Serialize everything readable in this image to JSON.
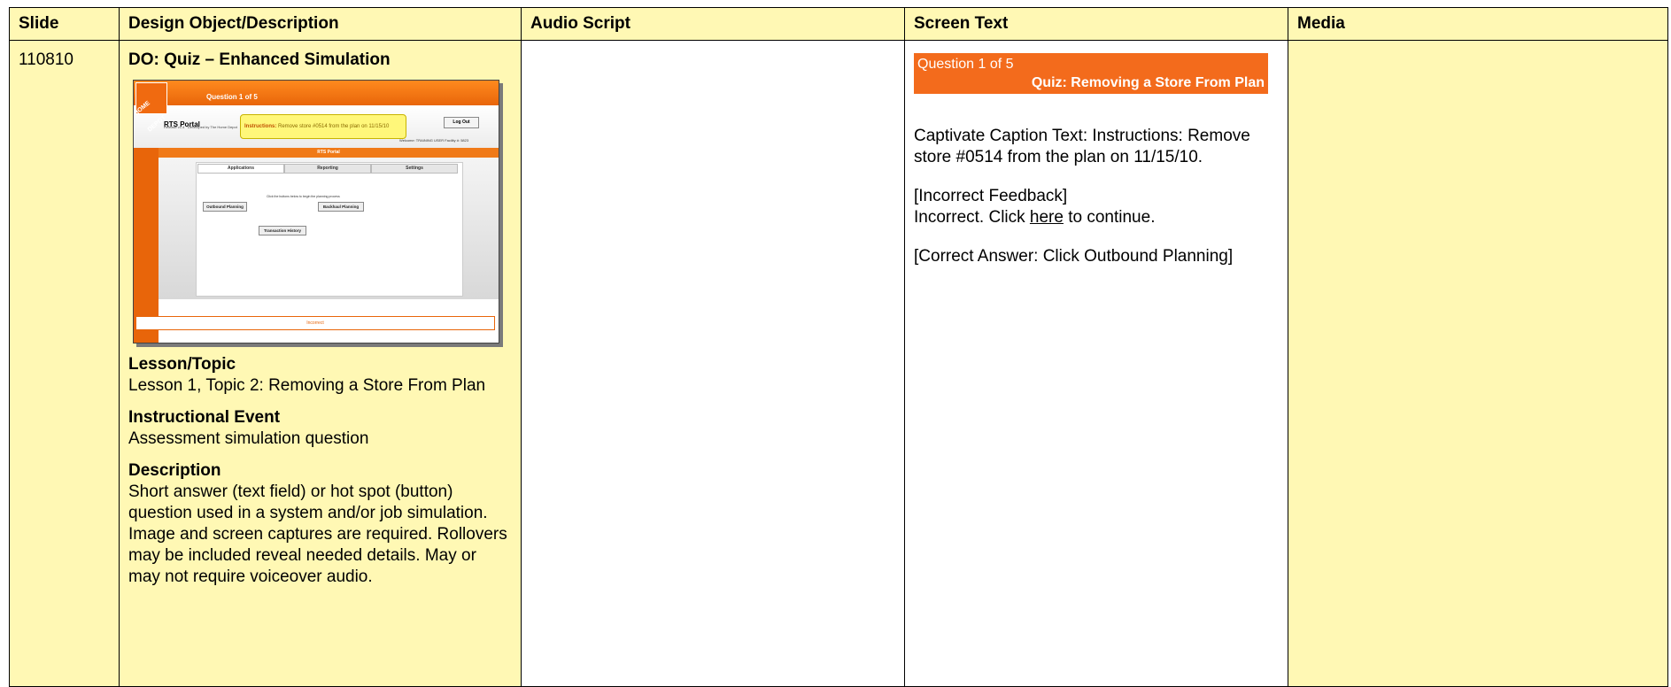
{
  "headers": {
    "slide": "Slide",
    "design": "Design Object/Description",
    "audio": "Audio Script",
    "screen": "Screen Text",
    "media": "Media"
  },
  "row": {
    "slide_number": "110810",
    "design": {
      "title": "DO: Quiz – Enhanced Simulation",
      "lesson_heading": "Lesson/Topic",
      "lesson_text": "Lesson 1, Topic 2: Removing a Store From Plan",
      "event_heading": "Instructional Event",
      "event_text": "Assessment simulation question",
      "desc_heading": "Description",
      "desc_text": "Short answer (text field) or hot spot (button) question used in a system and/or job simulation. Image and screen captures are required. Rollovers may be included reveal needed details. May or may not require voiceover audio."
    },
    "audio_text": "",
    "screen": {
      "question": "Question 1 of 5",
      "quiz_title": "Quiz: Removing a Store From Plan",
      "caption": "Captivate Caption Text: Instructions: Remove store #0514 from the plan on 11/15/10.",
      "incorrect_heading": "[Incorrect Feedback]",
      "incorrect_pre": "Incorrect. Click ",
      "incorrect_link": "here",
      "incorrect_post": " to continue.",
      "correct": "[Correct Answer: Click Outbound Planning]"
    },
    "media_text": ""
  },
  "thumbnail": {
    "question": "Question 1 of 5",
    "logo": "HOME DEPOT",
    "app_name": "RTS Portal",
    "app_small": "Release v1.4 · Developed by The Home Depot",
    "instr_label": "Instructions:",
    "instr_text": " Remove store #0514 from the plan on 11/15/10",
    "logout": "Log Out",
    "welcome": "Welcome: TRAINING USER   Facility #: 5823",
    "bar": "RTS Portal",
    "tabs": [
      "Applications",
      "Reporting",
      "Settings"
    ],
    "note": "Click the buttons below to begin the planning process",
    "btn_outbound": "Outbound Planning",
    "btn_backhaul": "Backhaul Planning",
    "btn_history": "Transaction History",
    "footer": "Incorrect"
  }
}
